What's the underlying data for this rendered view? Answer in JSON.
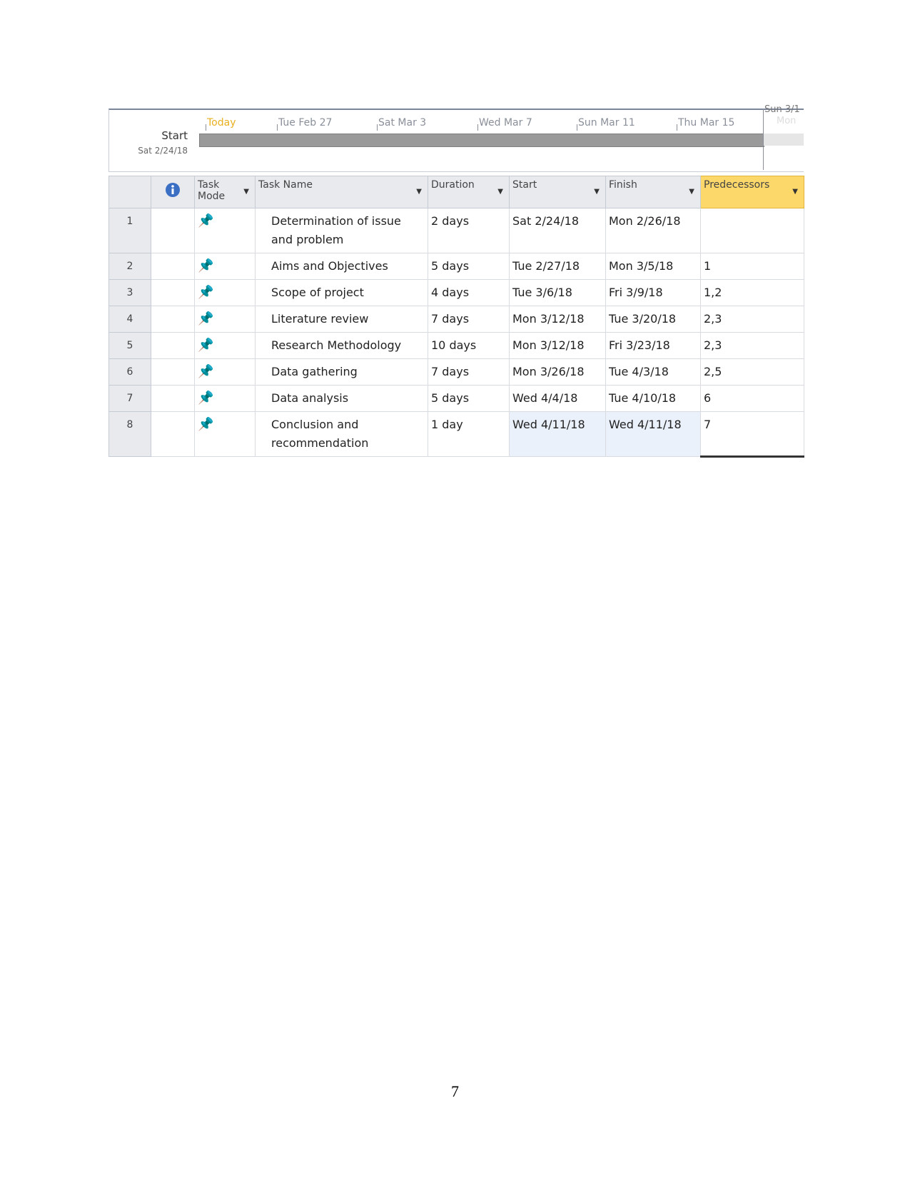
{
  "timeline": {
    "start_label": "Start",
    "start_date": "Sat 2/24/18",
    "today": "Today",
    "ticks": [
      "Tue Feb 27",
      "Sat Mar 3",
      "Wed Mar 7",
      "Sun Mar 11",
      "Thu Mar 15"
    ],
    "far_label": "Sun 3/1",
    "far_sub": "Mon"
  },
  "table": {
    "headers": {
      "info_icon": "info-icon",
      "task_mode": "Task Mode",
      "task_name": "Task Name",
      "duration": "Duration",
      "start": "Start",
      "finish": "Finish",
      "predecessors": "Predecessors"
    },
    "rows": [
      {
        "id": "1",
        "mode_icon": "pin-icon",
        "name": "Determination of issue and problem",
        "duration": "2 days",
        "start": "Sat 2/24/18",
        "finish": "Mon 2/26/18",
        "pred": ""
      },
      {
        "id": "2",
        "mode_icon": "pin-icon",
        "name": "Aims and Objectives",
        "duration": "5 days",
        "start": "Tue 2/27/18",
        "finish": "Mon 3/5/18",
        "pred": "1"
      },
      {
        "id": "3",
        "mode_icon": "pin-icon",
        "name": "Scope of project",
        "duration": "4 days",
        "start": "Tue 3/6/18",
        "finish": "Fri 3/9/18",
        "pred": "1,2"
      },
      {
        "id": "4",
        "mode_icon": "pin-icon",
        "name": "Literature review",
        "duration": "7 days",
        "start": "Mon 3/12/18",
        "finish": "Tue 3/20/18",
        "pred": "2,3"
      },
      {
        "id": "5",
        "mode_icon": "pin-icon",
        "name": "Research Methodology",
        "duration": "10 days",
        "start": "Mon 3/12/18",
        "finish": "Fri 3/23/18",
        "pred": "2,3"
      },
      {
        "id": "6",
        "mode_icon": "pin-icon",
        "name": "Data gathering",
        "duration": "7 days",
        "start": "Mon 3/26/18",
        "finish": "Tue 4/3/18",
        "pred": "2,5"
      },
      {
        "id": "7",
        "mode_icon": "pin-icon",
        "name": "Data analysis",
        "duration": "5 days",
        "start": "Wed 4/4/18",
        "finish": "Tue 4/10/18",
        "pred": "6"
      },
      {
        "id": "8",
        "mode_icon": "pin-icon",
        "name": "Conclusion and recommendation",
        "duration": "1 day",
        "start": "Wed 4/11/18",
        "finish": "Wed 4/11/18",
        "pred": "7"
      }
    ]
  },
  "colors": {
    "highlight_column": "#fcd769",
    "today": "#e8b020",
    "pin": "#2bb5a5"
  },
  "page_number": "7"
}
